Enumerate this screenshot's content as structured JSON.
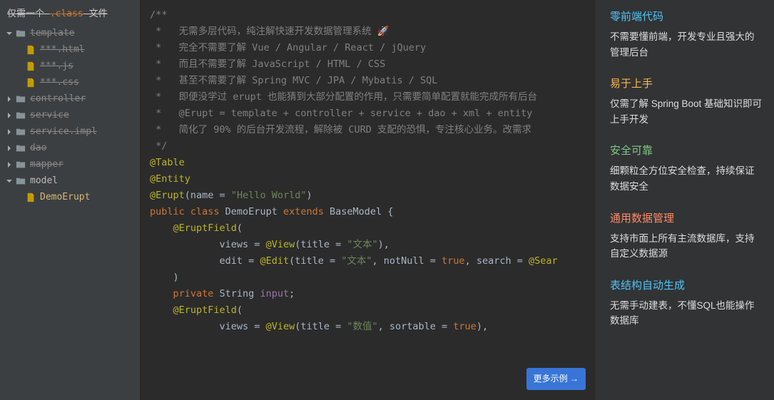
{
  "sidebar": {
    "header_prefix": "仅需一个 ",
    "header_class": ".class",
    "header_suffix": " 文件",
    "tree": [
      {
        "type": "folder",
        "label": "template",
        "expanded": true,
        "struck": true,
        "indent": 0
      },
      {
        "type": "file",
        "label": "***.html",
        "struck": true,
        "indent": 2
      },
      {
        "type": "file",
        "label": "***.js",
        "struck": true,
        "indent": 2
      },
      {
        "type": "file",
        "label": "***.css",
        "struck": true,
        "indent": 2
      },
      {
        "type": "folder",
        "label": "controller",
        "expanded": false,
        "struck": true,
        "indent": 0
      },
      {
        "type": "folder",
        "label": "service",
        "expanded": false,
        "struck": true,
        "indent": 0
      },
      {
        "type": "folder",
        "label": "service.impl",
        "expanded": false,
        "struck": true,
        "indent": 0
      },
      {
        "type": "folder",
        "label": "dao",
        "expanded": false,
        "struck": true,
        "indent": 0
      },
      {
        "type": "folder",
        "label": "mapper",
        "expanded": false,
        "struck": true,
        "indent": 0
      },
      {
        "type": "folder",
        "label": "model",
        "expanded": true,
        "struck": false,
        "indent": 0
      },
      {
        "type": "file",
        "label": "DemoErupt",
        "struck": false,
        "indent": 2,
        "golden": true
      }
    ]
  },
  "editor": {
    "lines": [
      {
        "segs": [
          {
            "t": "/**",
            "c": "cmt"
          }
        ]
      },
      {
        "segs": [
          {
            "t": " *   无需多层代码，纯注解快速开发数据管理系统 🚀",
            "c": "cmt"
          }
        ]
      },
      {
        "segs": [
          {
            "t": " *   完全不需要了解 Vue / Angular / React / jQuery",
            "c": "cmt"
          }
        ]
      },
      {
        "segs": [
          {
            "t": " *   而且不需要了解 JavaScript / HTML / CSS",
            "c": "cmt"
          }
        ]
      },
      {
        "segs": [
          {
            "t": " *   甚至不需要了解 Spring MVC / JPA / Mybatis / SQL",
            "c": "cmt"
          }
        ]
      },
      {
        "segs": [
          {
            "t": " *   即便没学过 erupt 也能猜到大部分配置的作用，只需要简单配置就能完成所有后台",
            "c": "cmt"
          }
        ]
      },
      {
        "segs": [
          {
            "t": " *   @Erupt = template + controller + service + dao + xml + entity",
            "c": "cmt"
          }
        ]
      },
      {
        "segs": [
          {
            "t": " *   简化了 90% 的后台开发流程，解除被 CURD 支配的恐惧，专注核心业务。改需求",
            "c": "cmt"
          }
        ]
      },
      {
        "segs": [
          {
            "t": " */",
            "c": "cmt"
          }
        ]
      },
      {
        "segs": [
          {
            "t": "@Table",
            "c": "anno"
          }
        ]
      },
      {
        "segs": [
          {
            "t": "@Entity",
            "c": "anno"
          }
        ]
      },
      {
        "segs": [
          {
            "t": "@Erupt",
            "c": "anno"
          },
          {
            "t": "(name = ",
            "c": "cls-name"
          },
          {
            "t": "\"Hello World\"",
            "c": "str"
          },
          {
            "t": ")",
            "c": "cls-name"
          }
        ]
      },
      {
        "segs": [
          {
            "t": "public class ",
            "c": "kw"
          },
          {
            "t": "DemoErupt ",
            "c": "cls-name"
          },
          {
            "t": "extends ",
            "c": "kw"
          },
          {
            "t": "BaseModel {",
            "c": "cls-name"
          }
        ]
      },
      {
        "segs": [
          {
            "t": "",
            "c": ""
          }
        ]
      },
      {
        "segs": [
          {
            "t": "    ",
            "c": ""
          },
          {
            "t": "@EruptField",
            "c": "anno"
          },
          {
            "t": "(",
            "c": "cls-name"
          }
        ]
      },
      {
        "segs": [
          {
            "t": "            views = ",
            "c": "cls-name"
          },
          {
            "t": "@View",
            "c": "anno"
          },
          {
            "t": "(title = ",
            "c": "cls-name"
          },
          {
            "t": "\"文本\"",
            "c": "str"
          },
          {
            "t": "),",
            "c": "cls-name"
          }
        ]
      },
      {
        "segs": [
          {
            "t": "            edit = ",
            "c": "cls-name"
          },
          {
            "t": "@Edit",
            "c": "anno"
          },
          {
            "t": "(title = ",
            "c": "cls-name"
          },
          {
            "t": "\"文本\"",
            "c": "str"
          },
          {
            "t": ", notNull = ",
            "c": "cls-name"
          },
          {
            "t": "true",
            "c": "tk-true"
          },
          {
            "t": ", search = ",
            "c": "cls-name"
          },
          {
            "t": "@Sear",
            "c": "anno"
          }
        ]
      },
      {
        "segs": [
          {
            "t": "    )",
            "c": "cls-name"
          }
        ]
      },
      {
        "segs": [
          {
            "t": "    ",
            "c": ""
          },
          {
            "t": "private ",
            "c": "kw"
          },
          {
            "t": "String ",
            "c": "cls-name"
          },
          {
            "t": "input",
            "c": "id"
          },
          {
            "t": ";",
            "c": "cls-name"
          }
        ]
      },
      {
        "segs": [
          {
            "t": "",
            "c": ""
          }
        ]
      },
      {
        "segs": [
          {
            "t": "    ",
            "c": ""
          },
          {
            "t": "@EruptField",
            "c": "anno"
          },
          {
            "t": "(",
            "c": "cls-name"
          }
        ]
      },
      {
        "segs": [
          {
            "t": "            views = ",
            "c": "cls-name"
          },
          {
            "t": "@View",
            "c": "anno"
          },
          {
            "t": "(title = ",
            "c": "cls-name"
          },
          {
            "t": "\"数值\"",
            "c": "str"
          },
          {
            "t": ", sortable = ",
            "c": "cls-name"
          },
          {
            "t": "true",
            "c": "tk-true"
          },
          {
            "t": "),",
            "c": "cls-name"
          }
        ]
      }
    ],
    "more_btn": "更多示例 →"
  },
  "features": [
    {
      "title": "零前端代码",
      "desc": "不需要懂前端，开发专业且强大的管理后台",
      "c": "c1"
    },
    {
      "title": "易于上手",
      "desc": "仅需了解 Spring Boot 基础知识即可上手开发",
      "c": "c2"
    },
    {
      "title": "安全可靠",
      "desc": "细颗粒全方位安全检查，持续保证数据安全",
      "c": "c3"
    },
    {
      "title": "通用数据管理",
      "desc": "支持市面上所有主流数据库，支持自定义数据源",
      "c": "c4"
    },
    {
      "title": "表结构自动生成",
      "desc": "无需手动建表，不懂SQL也能操作数据库",
      "c": "c5"
    }
  ]
}
